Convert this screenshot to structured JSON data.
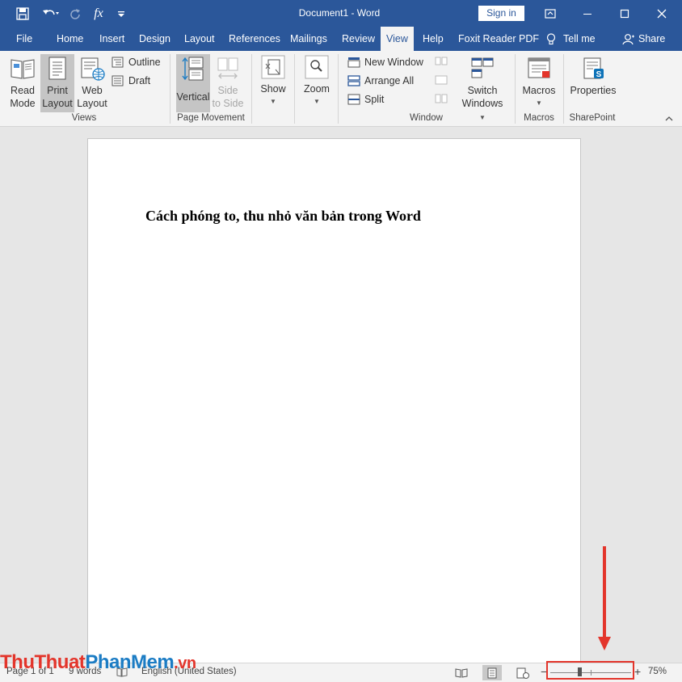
{
  "titlebar": {
    "title": "Document1  -  Word",
    "signin": "Sign in",
    "formula_glyph": "fx"
  },
  "tabs": [
    {
      "label": "File"
    },
    {
      "label": "Home"
    },
    {
      "label": "Insert"
    },
    {
      "label": "Design"
    },
    {
      "label": "Layout"
    },
    {
      "label": "References"
    },
    {
      "label": "Mailings"
    },
    {
      "label": "Review"
    },
    {
      "label": "View",
      "active": true
    },
    {
      "label": "Help"
    },
    {
      "label": "Foxit Reader PDF"
    },
    {
      "label": "Tell me"
    },
    {
      "label": "Share"
    }
  ],
  "ribbon": {
    "views": {
      "group": "Views",
      "read_mode": [
        "Read",
        "Mode"
      ],
      "print_layout": [
        "Print",
        "Layout"
      ],
      "web_layout": [
        "Web",
        "Layout"
      ],
      "outline": "Outline",
      "draft": "Draft"
    },
    "page_movement": {
      "group": "Page Movement",
      "vertical": "Vertical",
      "side_to_side": [
        "Side",
        "to Side"
      ]
    },
    "show": "Show",
    "zoom": "Zoom",
    "window": {
      "group": "Window",
      "new_window": "New Window",
      "arrange_all": "Arrange All",
      "split": "Split",
      "switch_windows": [
        "Switch",
        "Windows"
      ]
    },
    "macros": {
      "group": "Macros",
      "label": "Macros"
    },
    "sharepoint": {
      "group": "SharePoint",
      "label": "Properties"
    }
  },
  "document": {
    "heading": "Cách phóng to, thu nhỏ văn bản trong Word"
  },
  "status": {
    "page": "Page 1 of 1",
    "words": "9 words",
    "language": "English (United States)",
    "zoom_minus": "−",
    "zoom_plus": "+",
    "zoom_level": "75%",
    "zoom_fraction": 0.75
  },
  "watermark": {
    "part1": "ThuThuat",
    "part2": "PhanMem",
    "part3": ".vn"
  },
  "colors": {
    "brand": "#2b579a",
    "highlight": "#e3352b"
  }
}
